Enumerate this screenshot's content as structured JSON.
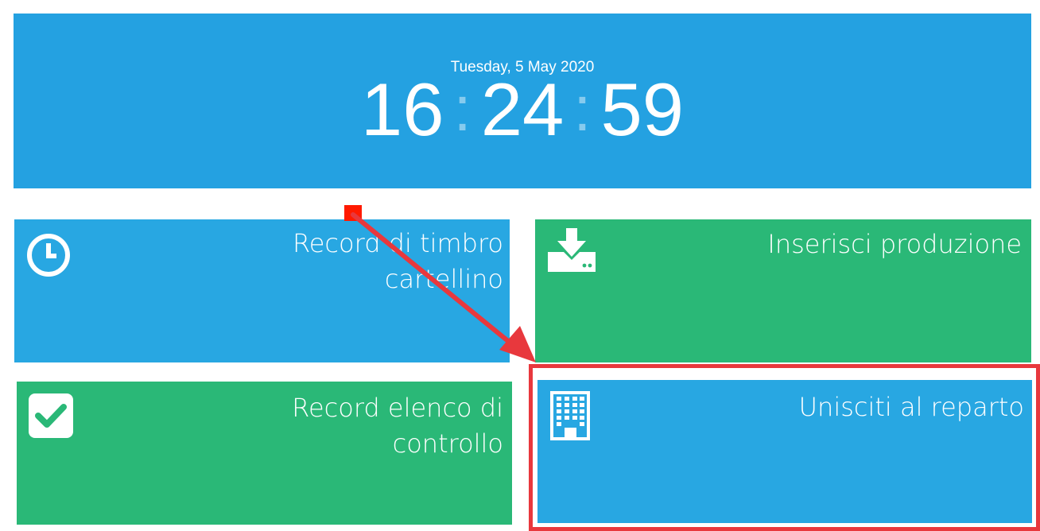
{
  "clock": {
    "date": "Tuesday, 5 May 2020",
    "hours": "16",
    "minutes": "24",
    "seconds": "59",
    "separator": ":"
  },
  "tiles": [
    {
      "label": "Record di timbro\ncartellino",
      "icon": "clock-icon",
      "color": "#28a7e2"
    },
    {
      "label": "Inserisci produzione",
      "icon": "download-tray-icon",
      "color": "#2ab877"
    },
    {
      "label": "Record elenco di\ncontrollo",
      "icon": "checkbox-icon",
      "color": "#2ab877"
    },
    {
      "label": "Unisciti al reparto",
      "icon": "building-icon",
      "color": "#28a7e2"
    }
  ],
  "colors": {
    "header_bg": "#24a1e1",
    "annotation": "#e8383d",
    "annotation_marker": "#ff1a00"
  }
}
